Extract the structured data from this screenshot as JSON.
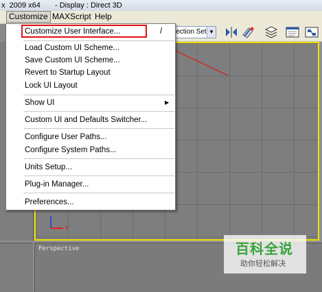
{
  "window": {
    "title_prefix": "x  2009 x64",
    "title_suffix": "- Display : Direct 3D"
  },
  "menubar": {
    "items": [
      {
        "label": "Customize"
      },
      {
        "label": "MAXScript"
      },
      {
        "label": "Help"
      }
    ]
  },
  "toolbar": {
    "selection_set": "lection Set",
    "icons": [
      "mirror-icon",
      "align-icon",
      "layer-manager-icon",
      "graphite-icon",
      "schematic-icon"
    ]
  },
  "dropdown": {
    "items": [
      {
        "label": "Customize User Interface...",
        "shortcut": "/"
      },
      {
        "label": "Load Custom UI Scheme..."
      },
      {
        "label": "Save Custom UI Scheme..."
      },
      {
        "label": "Revert to Startup Layout"
      },
      {
        "label": "Lock UI Layout"
      },
      {
        "label": "Show UI",
        "submenu": "▶"
      },
      {
        "label": "Custom UI and Defaults Switcher..."
      },
      {
        "label": "Configure User Paths..."
      },
      {
        "label": "Configure System Paths..."
      },
      {
        "label": "Units Setup..."
      },
      {
        "label": "Plug-in Manager..."
      },
      {
        "label": "Preferences..."
      }
    ]
  },
  "viewports": {
    "perspective_label": "Perspective",
    "axis_x": "x"
  },
  "annotation_color": "#e01010",
  "watermark": {
    "main": "百科全说",
    "sub": "助你轻松解决"
  }
}
